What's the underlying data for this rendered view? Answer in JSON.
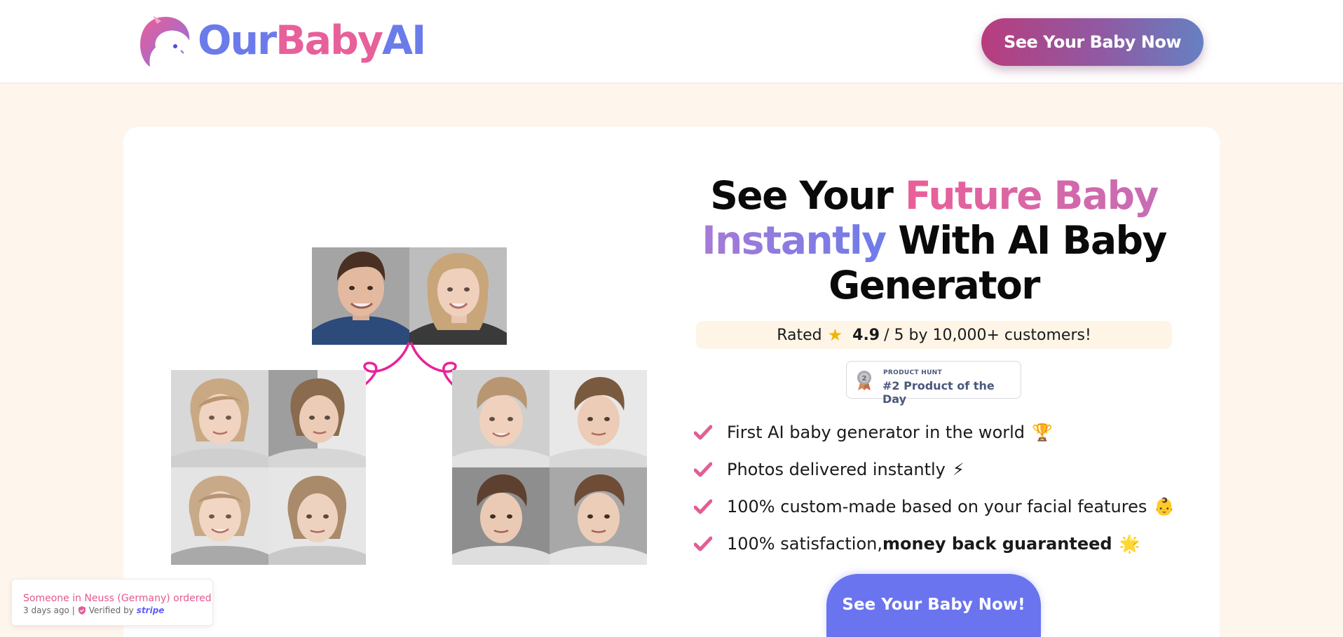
{
  "header": {
    "logo": {
      "our": "Our",
      "baby": "Baby",
      "ai": "AI",
      "icon": "unicorn-baby-logo-icon"
    },
    "cta_label": "See Your Baby Now"
  },
  "hero": {
    "headline": {
      "part1": "See Your ",
      "highlight1": "Future Baby",
      "highlight2": "Instantly",
      "part2": " With AI Baby Generator"
    },
    "rating": {
      "prefix": "Rated",
      "star_icon": "star-icon",
      "score": "4.9",
      "suffix": "/ 5 by 10,000+ customers!"
    },
    "product_hunt": {
      "small": "PRODUCT HUNT",
      "big": "#2 Product of the Day",
      "medal_icon": "medal-icon"
    },
    "features": [
      {
        "text": "First AI baby generator in the world",
        "bold": "",
        "emoji": "🏆",
        "icon": "check-icon"
      },
      {
        "text": "Photos delivered instantly",
        "bold": "",
        "emoji": "⚡",
        "icon": "check-icon"
      },
      {
        "text": "100% custom-made based on your facial features",
        "bold": "",
        "emoji": "👶",
        "icon": "check-icon"
      },
      {
        "text": "100% satisfaction, ",
        "bold": "money back guaranteed",
        "emoji": "🌟",
        "icon": "check-icon"
      }
    ],
    "cta_label": "See Your Baby Now!"
  },
  "toast": {
    "message": "Someone in Neuss (Germany) ordered",
    "time": "3 days ago |",
    "verified": "Verified by",
    "brand": "stripe"
  },
  "colors": {
    "accent_pink": "#e8609a",
    "accent_blue": "#6c7bea",
    "page_bg": "#fef6ec",
    "cta_blue": "#6a74ee"
  }
}
